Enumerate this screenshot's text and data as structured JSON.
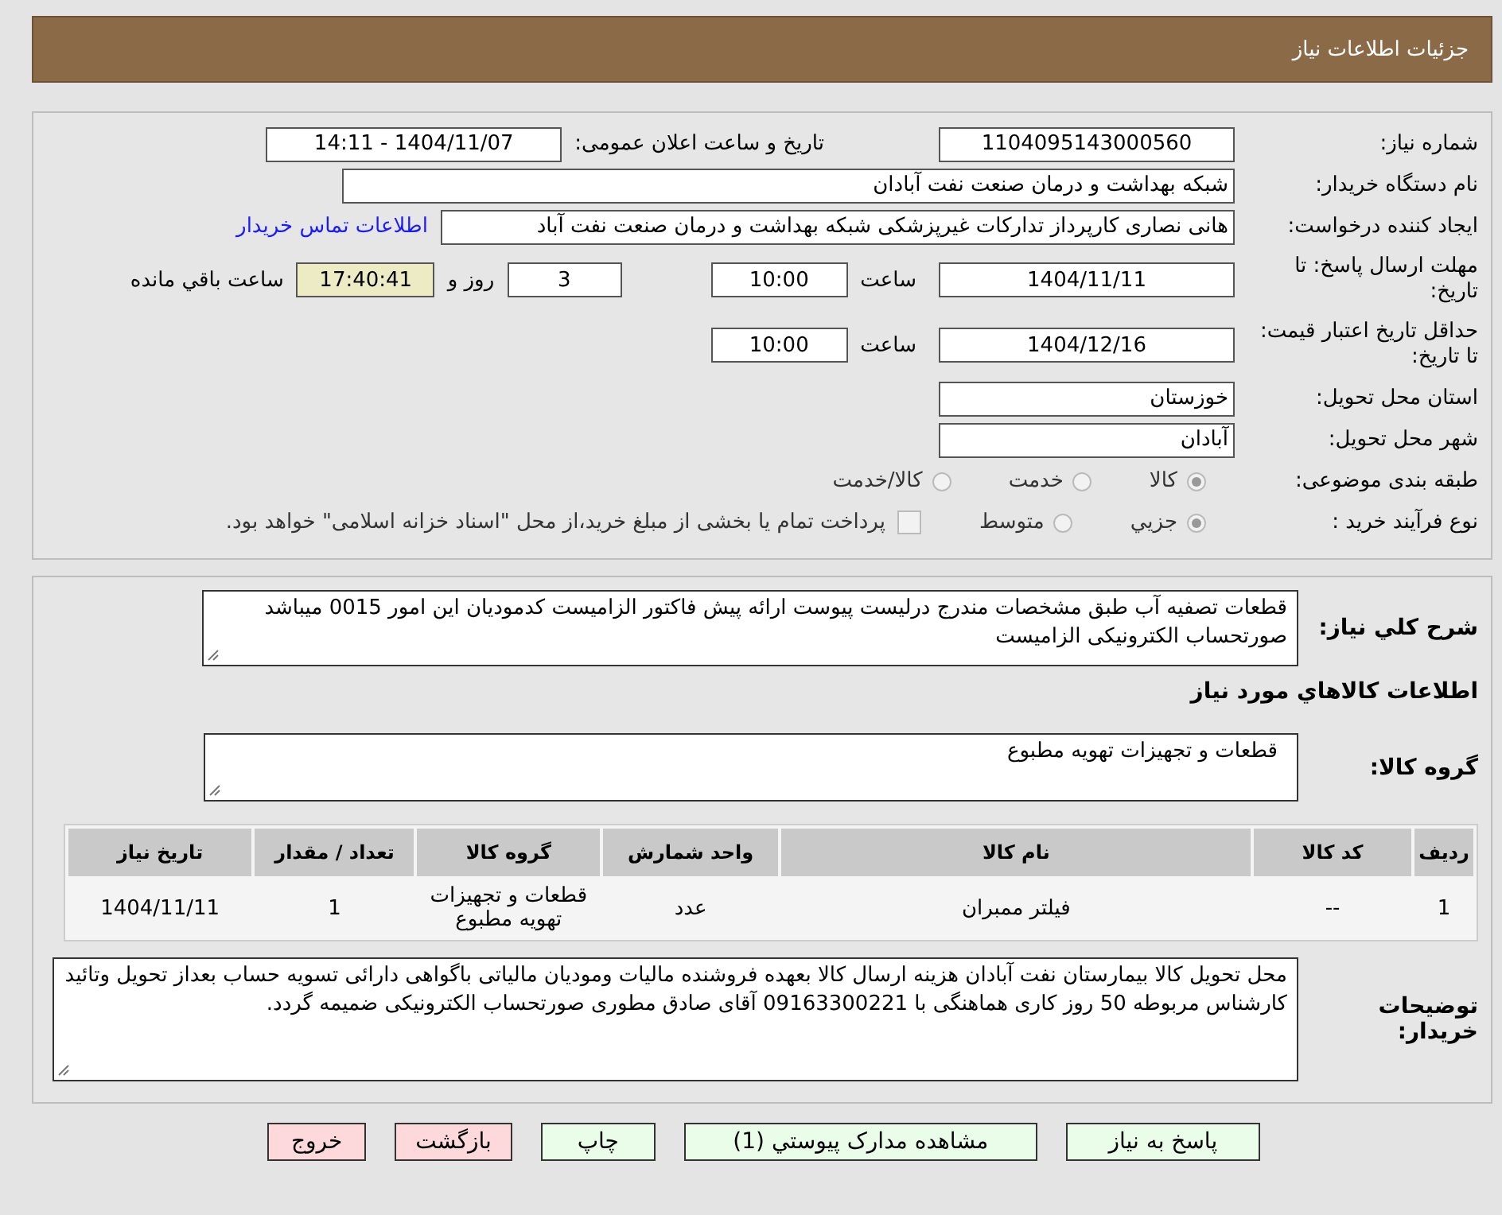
{
  "header": {
    "title": "جزئیات اطلاعات نیاز"
  },
  "details": {
    "need_number": {
      "label": "شماره نیاز:",
      "value": "1104095143000560"
    },
    "announce": {
      "label": "تاریخ و ساعت اعلان عمومی:",
      "value": "1404/11/07 - 14:11"
    },
    "buyer": {
      "label": "نام دستگاه خریدار:",
      "value": "شبکه بهداشت و درمان صنعت نفت آبادان"
    },
    "creator": {
      "label": "ایجاد کننده درخواست:",
      "value": "هانی نصاری کارپرداز تدارکات غیرپزشکی شبکه بهداشت و درمان صنعت نفت آباد",
      "link": "اطلاعات تماس خریدار"
    },
    "deadline": {
      "label": "مهلت ارسال پاسخ: تا تاریخ:",
      "date": "1404/11/11",
      "time_label": "ساعت",
      "time": "10:00",
      "days": "3",
      "days_label": "روز و",
      "remaining": "17:40:41",
      "remaining_label": "ساعت باقي مانده"
    },
    "validity": {
      "label": "حداقل تاریخ اعتبار قیمت: تا تاریخ:",
      "date": "1404/12/16",
      "time_label": "ساعت",
      "time": "10:00"
    },
    "province": {
      "label": "استان محل تحویل:",
      "value": "خوزستان"
    },
    "city": {
      "label": "شهر محل تحویل:",
      "value": "آبادان"
    },
    "category": {
      "label": "طبقه بندی موضوعی:",
      "options": [
        {
          "label": "کالا",
          "selected": true
        },
        {
          "label": "خدمت",
          "selected": false
        },
        {
          "label": "کالا/خدمت",
          "selected": false
        }
      ]
    },
    "process": {
      "label": "نوع فرآیند خرید :",
      "options": [
        {
          "label": "جزيي",
          "selected": true
        },
        {
          "label": "متوسط",
          "selected": false
        }
      ],
      "payment": {
        "label": "پرداخت تمام یا بخشی از مبلغ خرید،از محل \"اسناد خزانه اسلامی\" خواهد بود.",
        "checked": false
      }
    }
  },
  "goods": {
    "summary": {
      "label": "شرح کلي نیاز:",
      "value": "قطعات تصفیه آب طبق مشخصات مندرج درلیست پیوست ارائه پیش فاکتور الزامیست کدمودیان این امور 0015 میباشد صورتحساب الکترونیکی الزامیست"
    },
    "section_title": "اطلاعات کالاهاي مورد نیاز",
    "group": {
      "label": "گروه کالا:",
      "value": "قطعات و تجهیزات تهویه مطبوع"
    },
    "table": {
      "columns": [
        "ردیف",
        "کد کالا",
        "نام کالا",
        "واحد شمارش",
        "گروه کالا",
        "تعداد / مقدار",
        "تاریخ نیاز"
      ],
      "rows": [
        [
          "1",
          "--",
          "فیلتر ممبران",
          "عدد",
          "قطعات و تجهیزات تهویه مطبوع",
          "1",
          "1404/11/11"
        ]
      ]
    },
    "notes": {
      "label": "توضیحات خریدار:",
      "value": "محل تحویل کالا بیمارستان نفت آبادان هزینه ارسال کالا بعهده فروشنده مالیات ومودیان مالیاتی باگواهی دارائی تسویه حساب بعداز تحویل وتائید کارشناس مربوطه 50 روز کاری هماهنگی با 09163300221 آقای صادق مطوری صورتحساب الکترونیکی ضمیمه گردد."
    }
  },
  "buttons": [
    {
      "label": "پاسخ به نیاز",
      "kind": "normal"
    },
    {
      "label": "مشاهده مدارک پیوستي (1)",
      "kind": "normal"
    },
    {
      "label": "چاپ",
      "kind": "normal"
    },
    {
      "label": "بازگشت",
      "kind": "exit"
    },
    {
      "label": "خروج",
      "kind": "exit"
    }
  ]
}
